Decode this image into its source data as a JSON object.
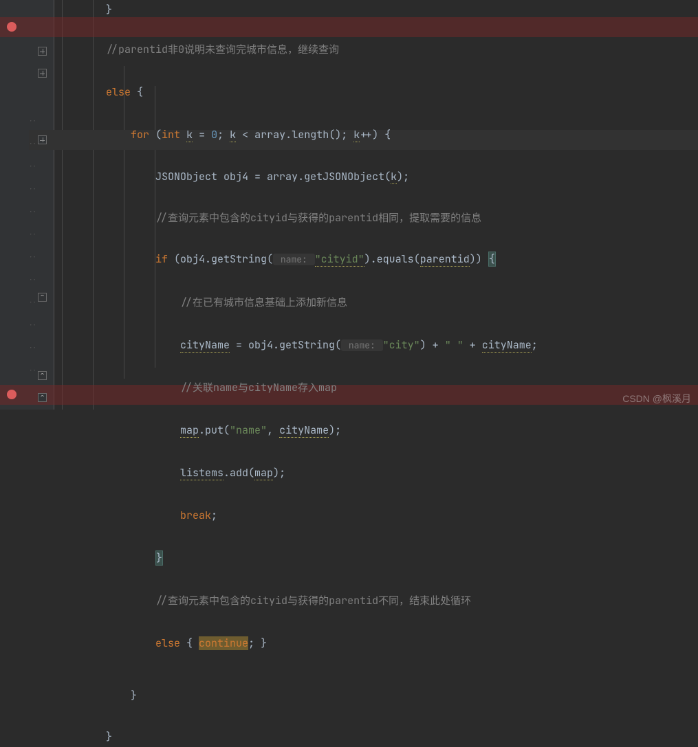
{
  "tokens": {
    "l1": {
      "slash": "//",
      "parentid": "parentid",
      "txt": "非0说明未查询完城市信息，继续查询"
    },
    "l2": {
      "else": "else ",
      "brace": "{"
    },
    "l3": {
      "for": "for ",
      "p1": "(",
      "int": "int ",
      "k": "k",
      "eq": " = ",
      "zero": "0",
      "semi1": "; ",
      "k2": "k",
      "lt": " < ",
      "array": "array",
      "dot": ".",
      "length": "length",
      "paren": "()",
      "semi2": "; ",
      "k3": "k",
      "pp": "++) {"
    },
    "l4": {
      "type": "JSONObject ",
      "obj": "obj4 = ",
      "array": "array",
      "call": ".getJSONObject(",
      "k": "k",
      "end": ");"
    },
    "l5": {
      "slash": "//",
      "txt1": "查询元素中包含的",
      "cityid": "cityid",
      "txt2": "与获得的",
      "parentid": "parentid",
      "txt3": "相同，提取需要的信息"
    },
    "l6": {
      "if": "if ",
      "p": "(obj4.getString(",
      "hint": " name: ",
      "str": "\"cityid\"",
      "p2": ").equals(",
      "parentid": "parentid",
      "p3": ")) ",
      "brace": "{"
    },
    "l7": {
      "slash": "//",
      "txt": "在已有城市信息基础上添加新信息"
    },
    "l8": {
      "cityName": "cityName",
      "eq": " = obj4.getString(",
      "hint": " name: ",
      "str": "\"city\"",
      "p": ") + ",
      "sp": "\" \"",
      "plus": " + ",
      "cityName2": "cityName",
      "semi": ";"
    },
    "l9": {
      "slash": "//",
      "txt": "关联name与cityName存入map"
    },
    "l10": {
      "map": "map",
      "put": ".put(",
      "str": "\"name\"",
      "comma": ", ",
      "cityName": "cityName",
      "end": ");"
    },
    "l11": {
      "listems": "listems",
      "add": ".add(",
      "map": "map",
      "end": ");"
    },
    "l12": {
      "break": "break",
      "semi": ";"
    },
    "l13": {
      "brace": "}"
    },
    "l14": {
      "slash": "//",
      "txt1": "查询元素中包含的",
      "cityid": "cityid",
      "txt2": "与获得的",
      "parentid": "parentid",
      "txt3": "不同，结束此处循环"
    },
    "l15": {
      "else": "else ",
      "b1": "{ ",
      "continue": "continue",
      "semi": ";",
      "b2": " }"
    },
    "l16": {
      "brace": "}"
    },
    "l17": {
      "brace": "}"
    }
  },
  "watermark": "CSDN @枫溪月"
}
